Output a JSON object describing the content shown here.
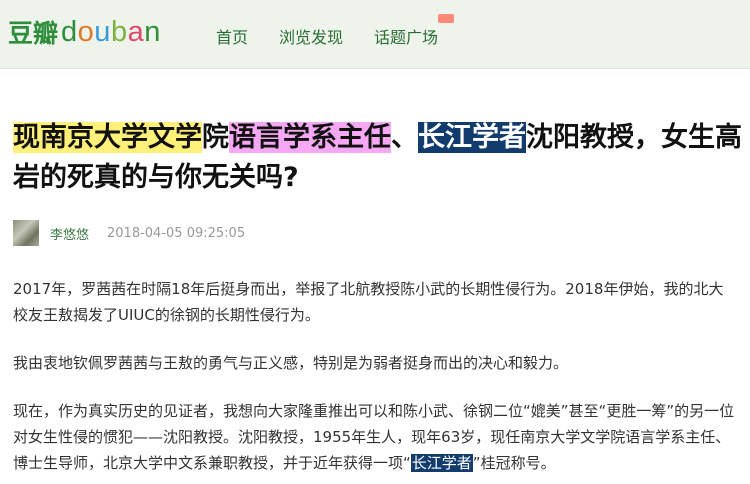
{
  "header": {
    "logo_cn": "豆瓣",
    "logo_en_letters": [
      "d",
      "o",
      "u",
      "b",
      "a",
      "n"
    ],
    "logo_en_colors": [
      "#2e8e3b",
      "#e07a2a",
      "#3a9ad9",
      "#7cb342",
      "#e04a6a",
      "#2e8e3b"
    ],
    "nav": [
      {
        "label": "首页"
      },
      {
        "label": "浏览发现"
      },
      {
        "label": "话题广场"
      }
    ],
    "badge_icon": "new-badge"
  },
  "article": {
    "title_parts": [
      {
        "text": "现南京大学文学",
        "style": "plain"
      },
      {
        "text": "院",
        "style": "plain"
      },
      {
        "text": "语言学系主任",
        "style": "pink"
      },
      {
        "text": "、",
        "style": "plain"
      },
      {
        "text": "长江学者",
        "style": "navy"
      },
      {
        "text": "沈阳教授，女生高岩的死真的与你无关吗?",
        "style": "plain"
      }
    ],
    "author": "李悠悠",
    "date": "2018-04-05 09:25:05",
    "p1": "2017年，罗茜茜在时隔18年后挺身而出，举报了北航教授陈小武的长期性侵行为。2018年伊始，我的北大校友王敖揭发了UIUC的徐钢的长期性侵行为。",
    "p2": "我由衷地钦佩罗茜茜与王敖的勇气与正义感，特别是为弱者挺身而出的决心和毅力。",
    "p3_before": "现在，作为真实历史的见证者，我想向大家隆重推出可以和陈小武、徐钢二位“媲美”甚至“更胜一筹”的另一位对女生性侵的惯犯——沈阳教授。沈阳教授，1955年生人，现年63岁，现任南京大学文学院语言学系主任、博士生导师，北京大学中文系兼职教授，并于近年获得一项“",
    "p3_highlight": "长江学者",
    "p3_after": "”桂冠称号。"
  }
}
